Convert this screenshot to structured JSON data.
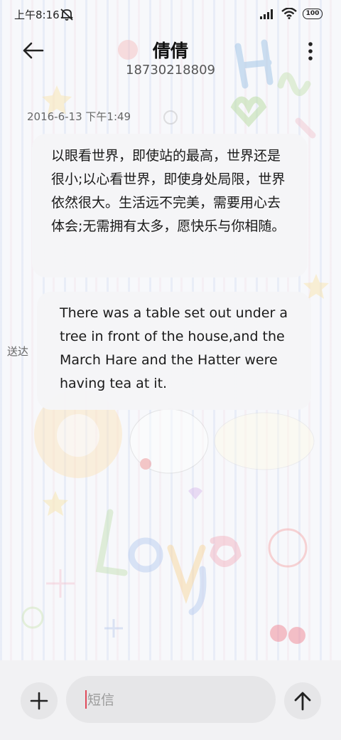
{
  "status_bar": {
    "time": "上午8:16",
    "mute_icon": "bell-off-icon",
    "signal_icon": "signal-icon",
    "wifi_icon": "wifi-icon",
    "battery": "100"
  },
  "header": {
    "back_icon": "back-arrow-icon",
    "contact_name": "倩倩",
    "contact_number": "18730218809",
    "more_icon": "more-vertical-icon"
  },
  "conversation": {
    "timestamp": "2016-6-13 下午1:49",
    "messages": [
      {
        "text": "以眼看世界，即使站的最高，世界还是很小;以心看世界，即使身处局限，世界依然很大。生活远不完美，需要用心去体会;无需拥有太多，愿快乐与你相随。"
      },
      {
        "text": "There was a table set out under a tree in front of the house,and the March Hare and the Hatter were having tea at it."
      }
    ],
    "send_status": "送达"
  },
  "input_bar": {
    "add_icon": "plus-icon",
    "placeholder": "短信",
    "value": "",
    "send_icon": "arrow-up-icon"
  },
  "colors": {
    "caret": "#e04a5a",
    "bubble": "#f5f5f7",
    "input_bg": "#e6e6e8"
  }
}
